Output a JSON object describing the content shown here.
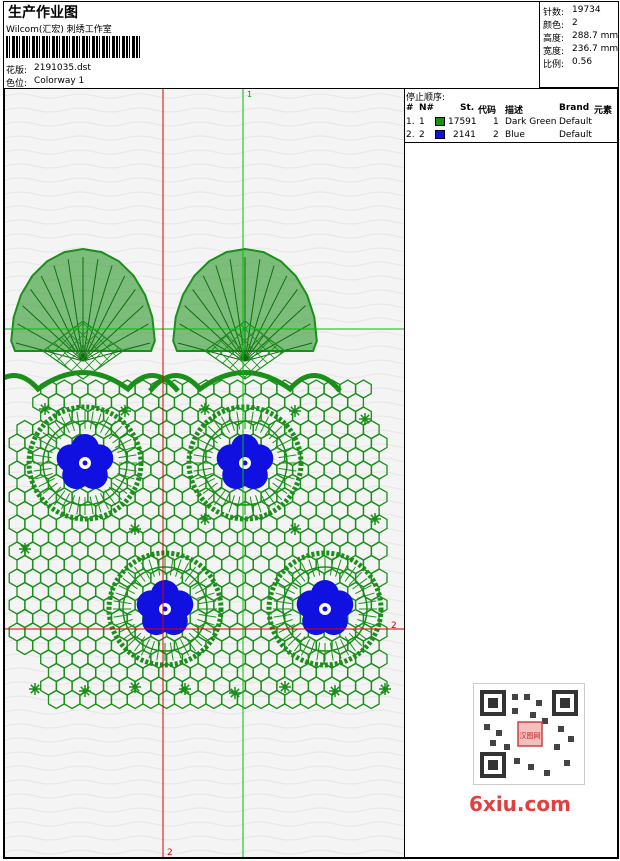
{
  "header": {
    "title": "生产作业图",
    "studio": "Wilcom(汇宏) 刺绣工作室",
    "design_label": "花版:",
    "design_value": "2191035.dst",
    "colorway_label": "色位:",
    "colorway_value": "Colorway 1"
  },
  "info": {
    "stitches_label": "针数:",
    "stitches_value": "19734",
    "colors_label": "颜色:",
    "colors_value": "2",
    "height_label": "高度:",
    "height_value": "288.7 mm",
    "width_label": "宽度:",
    "width_value": "236.7 mm",
    "scale_label": "比例:",
    "scale_value": "0.56"
  },
  "stop_sequence": {
    "title": "停止顺序:",
    "headers": [
      "#",
      "N#",
      "St.",
      "代码",
      "描述",
      "Brand",
      "元素"
    ],
    "rows": [
      {
        "index": "1.",
        "n": "1",
        "stitches": "17591",
        "code": "1",
        "description": "Dark Green",
        "brand": "Default",
        "color": "#1a8f1a"
      },
      {
        "index": "2.",
        "n": "2",
        "stitches": "2141",
        "code": "2",
        "description": "Blue",
        "brand": "Default",
        "color": "#1010e0"
      }
    ]
  },
  "guides": {
    "green_label": "1",
    "red_right_label": "2",
    "red_bottom_label": "2"
  },
  "watermark": {
    "text": "6xiu.com",
    "seal_text": "汉图网"
  },
  "colors": {
    "green": "#1a8f1a",
    "blue": "#1010e0",
    "guide_red": "#e00000",
    "guide_green": "#00c000"
  }
}
